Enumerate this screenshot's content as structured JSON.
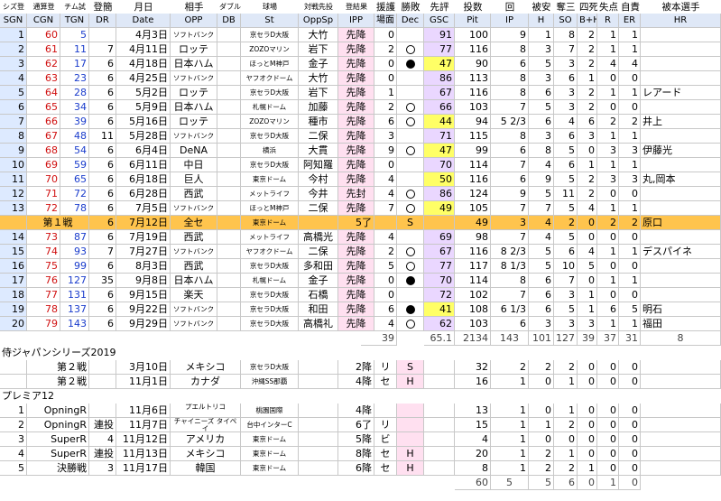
{
  "headers_top": [
    "シズ登",
    "通算登",
    "チム試",
    "登簡",
    "月日",
    "相手",
    "ダブル",
    "球場",
    "対戦先投",
    "登結果",
    "援護",
    "勝敗",
    "先評",
    "投数",
    "回",
    "被安",
    "奪三",
    "四死",
    "失点",
    "自責",
    "被本選手"
  ],
  "headers_sub": [
    "SGN",
    "CGN",
    "TGN",
    "DR",
    "Date",
    "OPP",
    "DB",
    "St",
    "OppSp",
    "IPP",
    "場面",
    "Dec",
    "GSC",
    "Pit",
    "IP",
    "H",
    "SO",
    "B+H",
    "R",
    "ER",
    "HR"
  ],
  "season_rows": [
    {
      "sgn": "1",
      "cgn": "60",
      "tgn": "5",
      "dr": "",
      "date": "4月3日",
      "opp": "ソフトバンク",
      "db": "",
      "st": "京セラD大阪",
      "oppsp": "大竹",
      "ipp": "先降",
      "sc": "0",
      "dec": "",
      "gsc": "91",
      "pit": "100",
      "ip": "9",
      "h": "1",
      "so": "8",
      "bh": "2",
      "r": "1",
      "er": "1",
      "hr": ""
    },
    {
      "sgn": "2",
      "cgn": "61",
      "tgn": "11",
      "dr": "7",
      "date": "4月11日",
      "opp": "ロッテ",
      "db": "",
      "st": "ZOZOマリン",
      "oppsp": "岩下",
      "ipp": "先降",
      "sc": "2",
      "dec": "win",
      "gsc": "77",
      "pit": "116",
      "ip": "8",
      "h": "3",
      "so": "7",
      "bh": "2",
      "r": "1",
      "er": "1",
      "hr": ""
    },
    {
      "sgn": "3",
      "cgn": "62",
      "tgn": "17",
      "dr": "6",
      "date": "4月18日",
      "opp": "日本ハム",
      "db": "",
      "st": "ほっとM神戸",
      "oppsp": "金子",
      "ipp": "先降",
      "sc": "0",
      "dec": "loss",
      "gsc": "47",
      "pit": "90",
      "ip": "6",
      "h": "5",
      "so": "3",
      "bh": "2",
      "r": "4",
      "er": "4",
      "hr": ""
    },
    {
      "sgn": "4",
      "cgn": "63",
      "tgn": "23",
      "dr": "6",
      "date": "4月25日",
      "opp": "ソフトバンク",
      "db": "",
      "st": "ヤフオクドーム",
      "oppsp": "大竹",
      "ipp": "先降",
      "sc": "0",
      "dec": "",
      "gsc": "86",
      "pit": "113",
      "ip": "8",
      "h": "3",
      "so": "6",
      "bh": "1",
      "r": "0",
      "er": "0",
      "hr": ""
    },
    {
      "sgn": "5",
      "cgn": "64",
      "tgn": "28",
      "dr": "6",
      "date": "5月2日",
      "opp": "ロッテ",
      "db": "",
      "st": "京セラD大阪",
      "oppsp": "岩下",
      "ipp": "先降",
      "sc": "1",
      "dec": "",
      "gsc": "67",
      "pit": "116",
      "ip": "8",
      "h": "6",
      "so": "3",
      "bh": "2",
      "r": "1",
      "er": "1",
      "hr": "レアード"
    },
    {
      "sgn": "6",
      "cgn": "65",
      "tgn": "34",
      "dr": "6",
      "date": "5月9日",
      "opp": "日本ハム",
      "db": "",
      "st": "札幌ドーム",
      "oppsp": "加藤",
      "ipp": "先降",
      "sc": "2",
      "dec": "win",
      "gsc": "66",
      "pit": "103",
      "ip": "7",
      "h": "5",
      "so": "3",
      "bh": "2",
      "r": "0",
      "er": "0",
      "hr": ""
    },
    {
      "sgn": "7",
      "cgn": "66",
      "tgn": "39",
      "dr": "6",
      "date": "5月16日",
      "opp": "ロッテ",
      "db": "",
      "st": "ZOZOマリン",
      "oppsp": "種市",
      "ipp": "先降",
      "sc": "6",
      "dec": "win",
      "gsc": "44",
      "pit": "94",
      "ip": "5 2/3",
      "h": "6",
      "so": "4",
      "bh": "6",
      "r": "2",
      "er": "2",
      "hr": "井上"
    },
    {
      "sgn": "8",
      "cgn": "67",
      "tgn": "48",
      "dr": "11",
      "date": "5月28日",
      "opp": "ソフトバンク",
      "db": "",
      "st": "京セラD大阪",
      "oppsp": "二保",
      "ipp": "先降",
      "sc": "3",
      "dec": "",
      "gsc": "71",
      "pit": "115",
      "ip": "8",
      "h": "3",
      "so": "6",
      "bh": "3",
      "r": "1",
      "er": "1",
      "hr": ""
    },
    {
      "sgn": "9",
      "cgn": "68",
      "tgn": "54",
      "dr": "6",
      "date": "6月4日",
      "opp": "DeNA",
      "db": "",
      "st": "横浜",
      "oppsp": "大貫",
      "ipp": "先降",
      "sc": "9",
      "dec": "win",
      "gsc": "47",
      "pit": "99",
      "ip": "6",
      "h": "8",
      "so": "5",
      "bh": "0",
      "r": "3",
      "er": "3",
      "hr": "伊藤光"
    },
    {
      "sgn": "10",
      "cgn": "69",
      "tgn": "59",
      "dr": "6",
      "date": "6月11日",
      "opp": "中日",
      "db": "",
      "st": "京セラD大阪",
      "oppsp": "阿知羅",
      "ipp": "先降",
      "sc": "0",
      "dec": "",
      "gsc": "70",
      "pit": "114",
      "ip": "7",
      "h": "4",
      "so": "6",
      "bh": "1",
      "r": "1",
      "er": "1",
      "hr": ""
    },
    {
      "sgn": "11",
      "cgn": "70",
      "tgn": "65",
      "dr": "6",
      "date": "6月18日",
      "opp": "巨人",
      "db": "",
      "st": "東京ドーム",
      "oppsp": "今村",
      "ipp": "先降",
      "sc": "4",
      "dec": "",
      "gsc": "50",
      "pit": "116",
      "ip": "6",
      "h": "9",
      "so": "5",
      "bh": "2",
      "r": "3",
      "er": "3",
      "hr": "丸,岡本"
    },
    {
      "sgn": "12",
      "cgn": "71",
      "tgn": "72",
      "dr": "6",
      "date": "6月28日",
      "opp": "西武",
      "db": "",
      "st": "メットライフ",
      "oppsp": "今井",
      "ipp": "先封",
      "sc": "4",
      "dec": "win",
      "gsc": "86",
      "pit": "124",
      "ip": "9",
      "h": "5",
      "so": "11",
      "bh": "2",
      "r": "0",
      "er": "0",
      "hr": ""
    },
    {
      "sgn": "13",
      "cgn": "72",
      "tgn": "78",
      "dr": "6",
      "date": "7月5日",
      "opp": "ソフトバンク",
      "db": "",
      "st": "ほっとM神戸",
      "oppsp": "二保",
      "ipp": "先降",
      "sc": "7",
      "dec": "win",
      "gsc": "49",
      "pit": "105",
      "ip": "7",
      "h": "7",
      "so": "5",
      "bh": "4",
      "r": "1",
      "er": "1",
      "hr": ""
    }
  ],
  "allstar": {
    "label": "第１戦",
    "dr": "6",
    "date": "7月12日",
    "opp": "全セ",
    "st": "東京ドーム",
    "ipp": "5了",
    "dec": "S",
    "pit": "49",
    "ip": "3",
    "h": "4",
    "so": "2",
    "bh": "0",
    "r": "2",
    "er": "2",
    "hr": "原口"
  },
  "season_rows2": [
    {
      "sgn": "14",
      "cgn": "73",
      "tgn": "87",
      "dr": "6",
      "date": "7月19日",
      "opp": "西武",
      "db": "",
      "st": "メットライフ",
      "oppsp": "高橋光",
      "ipp": "先降",
      "sc": "4",
      "dec": "",
      "gsc": "69",
      "pit": "98",
      "ip": "7",
      "h": "4",
      "so": "5",
      "bh": "0",
      "r": "0",
      "er": "0",
      "hr": ""
    },
    {
      "sgn": "15",
      "cgn": "74",
      "tgn": "93",
      "dr": "7",
      "date": "7月27日",
      "opp": "ソフトバンク",
      "db": "",
      "st": "ヤフオクドーム",
      "oppsp": "二保",
      "ipp": "先降",
      "sc": "2",
      "dec": "win",
      "gsc": "67",
      "pit": "116",
      "ip": "8 2/3",
      "h": "5",
      "so": "6",
      "bh": "4",
      "r": "1",
      "er": "1",
      "hr": "デスパイネ"
    },
    {
      "sgn": "16",
      "cgn": "75",
      "tgn": "99",
      "dr": "6",
      "date": "8月3日",
      "opp": "西武",
      "db": "",
      "st": "京セラD大阪",
      "oppsp": "多和田",
      "ipp": "先降",
      "sc": "5",
      "dec": "win",
      "gsc": "77",
      "pit": "117",
      "ip": "8 1/3",
      "h": "5",
      "so": "10",
      "bh": "5",
      "r": "0",
      "er": "0",
      "hr": ""
    },
    {
      "sgn": "17",
      "cgn": "76",
      "tgn": "127",
      "dr": "35",
      "date": "9月8日",
      "opp": "日本ハム",
      "db": "",
      "st": "札幌ドーム",
      "oppsp": "金子",
      "ipp": "先降",
      "sc": "0",
      "dec": "loss",
      "gsc": "70",
      "pit": "114",
      "ip": "8",
      "h": "6",
      "so": "7",
      "bh": "0",
      "r": "1",
      "er": "1",
      "hr": ""
    },
    {
      "sgn": "18",
      "cgn": "77",
      "tgn": "131",
      "dr": "6",
      "date": "9月15日",
      "opp": "楽天",
      "db": "",
      "st": "京セラD大阪",
      "oppsp": "石橋",
      "ipp": "先降",
      "sc": "0",
      "dec": "",
      "gsc": "72",
      "pit": "102",
      "ip": "7",
      "h": "6",
      "so": "3",
      "bh": "1",
      "r": "0",
      "er": "0",
      "hr": ""
    },
    {
      "sgn": "19",
      "cgn": "78",
      "tgn": "137",
      "dr": "6",
      "date": "9月22日",
      "opp": "ソフトバンク",
      "db": "",
      "st": "京セラD大阪",
      "oppsp": "和田",
      "ipp": "先降",
      "sc": "6",
      "dec": "loss",
      "gsc": "41",
      "pit": "108",
      "ip": "6 1/3",
      "h": "6",
      "so": "5",
      "bh": "1",
      "r": "6",
      "er": "5",
      "hr": "明石"
    },
    {
      "sgn": "20",
      "cgn": "79",
      "tgn": "143",
      "dr": "6",
      "date": "9月29日",
      "opp": "ソフトバンク",
      "db": "",
      "st": "京セラD大阪",
      "oppsp": "高橋礼",
      "ipp": "先降",
      "sc": "4",
      "dec": "win",
      "gsc": "62",
      "pit": "103",
      "ip": "6",
      "h": "3",
      "so": "3",
      "bh": "3",
      "r": "1",
      "er": "1",
      "hr": "福田"
    }
  ],
  "season_total": {
    "sc": "39",
    "gsc": "65.1",
    "pit": "2134",
    "ip": "143",
    "h": "101",
    "so": "127",
    "bh": "39",
    "r": "37",
    "er": "31",
    "hr": "8"
  },
  "samurai_title": "侍ジャパンシリーズ2019",
  "samurai_rows": [
    {
      "label": "第２戦",
      "date": "3月10日",
      "opp": "メキシコ",
      "st": "京セラD大阪",
      "ipp": "2降",
      "sc": "リ",
      "dec": "S",
      "pit": "32",
      "ip": "2",
      "h": "2",
      "so": "2",
      "bh": "0",
      "r": "0",
      "er": "0"
    },
    {
      "label": "第２戦",
      "date": "11月1日",
      "opp": "カナダ",
      "st": "沖縄SS那覇",
      "ipp": "4降",
      "sc": "セ",
      "dec": "H",
      "pit": "16",
      "ip": "1",
      "h": "0",
      "so": "1",
      "bh": "0",
      "r": "0",
      "er": "0"
    }
  ],
  "premier_title": "プレミア12",
  "premier_rows": [
    {
      "no": "1",
      "label": "OpningR",
      "dr": "",
      "date": "11月6日",
      "opp": "プエルトリコ",
      "st": "桃園国際",
      "ipp": "4降",
      "sc": "",
      "dec": "",
      "pit": "13",
      "ip": "1",
      "h": "0",
      "so": "1",
      "bh": "0",
      "r": "0",
      "er": "0"
    },
    {
      "no": "2",
      "label": "OpningR",
      "dr": "連投",
      "date": "11月7日",
      "opp": "チャイニーズ タイペイ",
      "st": "台中インターC",
      "ipp": "6了",
      "sc": "リ",
      "dec": "",
      "pit": "15",
      "ip": "1",
      "h": "1",
      "so": "2",
      "bh": "0",
      "r": "0",
      "er": "0"
    },
    {
      "no": "3",
      "label": "SuperR",
      "dr": "4",
      "date": "11月12日",
      "opp": "アメリカ",
      "st": "東京ドーム",
      "ipp": "5降",
      "sc": "ビ",
      "dec": "",
      "pit": "4",
      "ip": "1",
      "h": "0",
      "so": "0",
      "bh": "0",
      "r": "0",
      "er": "0"
    },
    {
      "no": "4",
      "label": "SuperR",
      "dr": "連投",
      "date": "11月13日",
      "opp": "メキシコ",
      "st": "東京ドーム",
      "ipp": "8降",
      "sc": "セ",
      "dec": "H",
      "pit": "20",
      "ip": "1",
      "h": "2",
      "so": "1",
      "bh": "0",
      "r": "0",
      "er": "0"
    },
    {
      "no": "5",
      "label": "決勝戦",
      "dr": "3",
      "date": "11月17日",
      "opp": "韓国",
      "st": "東京ドーム",
      "ipp": "6降",
      "sc": "セ",
      "dec": "H",
      "pit": "8",
      "ip": "1",
      "h": "2",
      "so": "2",
      "bh": "1",
      "r": "0",
      "er": "0"
    }
  ],
  "premier_total": {
    "pit": "60",
    "ip": "5",
    "h": "5",
    "so": "6",
    "bh": "0",
    "r": "1",
    "er": "0"
  }
}
